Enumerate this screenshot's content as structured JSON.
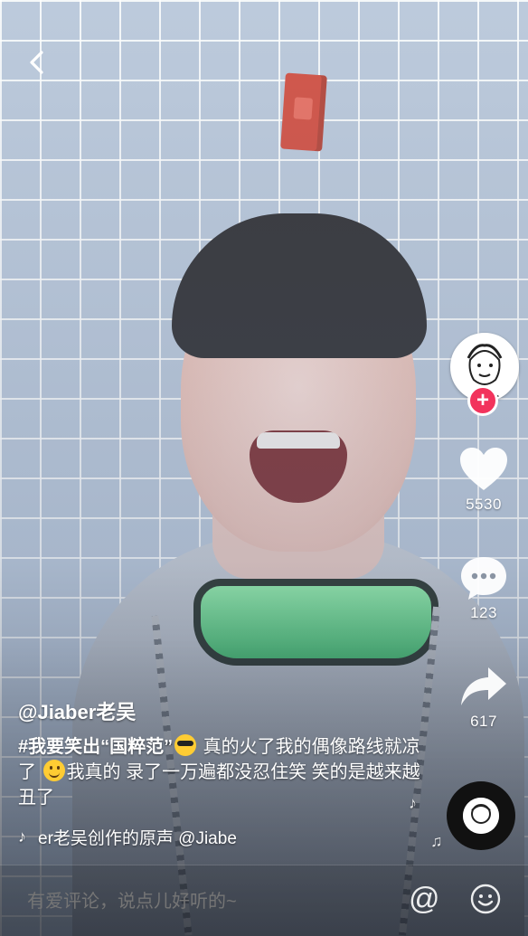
{
  "video": {
    "author_handle": "@Jiaber老吴",
    "description": {
      "hashtag": "#我要笑出“国粹范”",
      "part1": " 真的火了我的偶像路线就凉了 ",
      "part2": "我真的 录了一万遍都没忍住笑 笑的是越来越丑了"
    },
    "music": {
      "icon": "tiktok-note-icon",
      "text": "er老吴创作的原声    @Jiabe"
    }
  },
  "actions": {
    "likes": "5530",
    "comments": "123",
    "shares": "617"
  },
  "comment_bar": {
    "placeholder": "有爱评论，说点儿好听的~",
    "at_symbol": "@"
  },
  "colors": {
    "follow_accent": "#f2335c",
    "text": "#ffffff"
  }
}
